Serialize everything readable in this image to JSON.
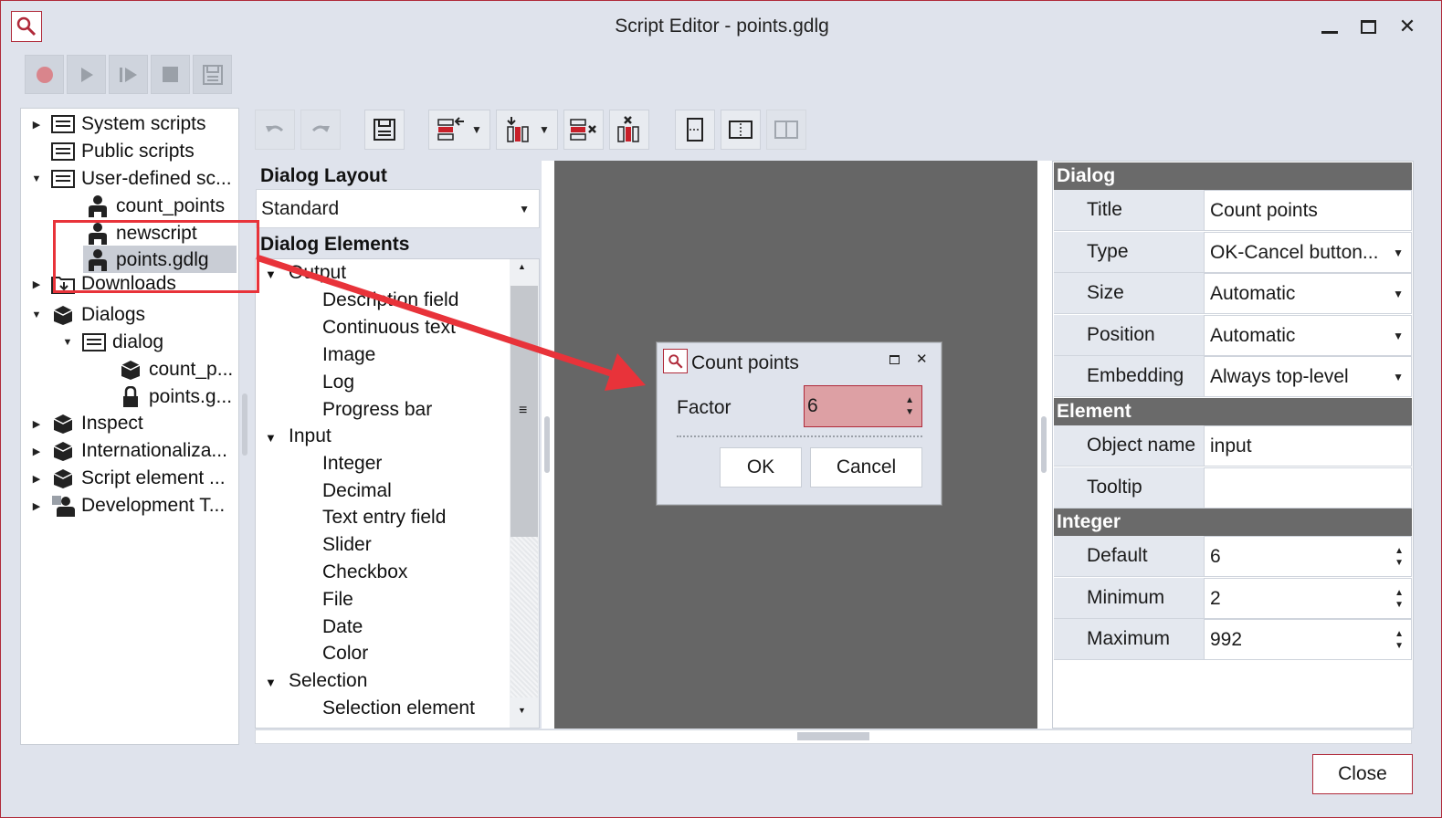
{
  "window": {
    "title": "Script Editor - points.gdlg",
    "close_label": "Close"
  },
  "tree": {
    "items": [
      {
        "label": "System scripts"
      },
      {
        "label": "Public scripts"
      },
      {
        "label": "User-defined sc..."
      },
      {
        "label": "count_points"
      },
      {
        "label": "newscript"
      },
      {
        "label": "points.gdlg"
      },
      {
        "label": "Downloads"
      },
      {
        "label": "Dialogs"
      },
      {
        "label": "dialog"
      },
      {
        "label": "count_p..."
      },
      {
        "label": "points.g..."
      },
      {
        "label": "Inspect"
      },
      {
        "label": "Internationaliza..."
      },
      {
        "label": "Script element ..."
      },
      {
        "label": "Development T..."
      }
    ]
  },
  "layout": {
    "heading": "Dialog Layout",
    "selected": "Standard"
  },
  "elements": {
    "heading": "Dialog Elements",
    "groups": [
      {
        "label": "Output",
        "items": [
          "Description field",
          "Continuous text",
          "Image",
          "Log",
          "Progress bar"
        ]
      },
      {
        "label": "Input",
        "items": [
          "Integer",
          "Decimal",
          "Text entry field",
          "Slider",
          "Checkbox",
          "File",
          "Date",
          "Color"
        ]
      },
      {
        "label": "Selection",
        "items": [
          "Selection element"
        ]
      }
    ]
  },
  "preview": {
    "title": "Count points",
    "field_label": "Factor",
    "field_value": "6",
    "ok_label": "OK",
    "cancel_label": "Cancel"
  },
  "properties": {
    "dialog_header": "Dialog",
    "element_header": "Element",
    "integer_header": "Integer",
    "dialog": [
      {
        "label": "Title",
        "value": "Count points"
      },
      {
        "label": "Type",
        "value": "OK-Cancel button..."
      },
      {
        "label": "Size",
        "value": "Automatic"
      },
      {
        "label": "Position",
        "value": "Automatic"
      },
      {
        "label": "Embedding",
        "value": "Always top-level"
      }
    ],
    "element": [
      {
        "label": "Object name",
        "value": "input"
      },
      {
        "label": "Tooltip",
        "value": ""
      }
    ],
    "integer": [
      {
        "label": "Default",
        "value": "6"
      },
      {
        "label": "Minimum",
        "value": "2"
      },
      {
        "label": "Maximum",
        "value": "992"
      }
    ]
  },
  "colors": {
    "accent": "#b02a3a",
    "highlight": "#e8333a",
    "canvas": "#666666"
  }
}
